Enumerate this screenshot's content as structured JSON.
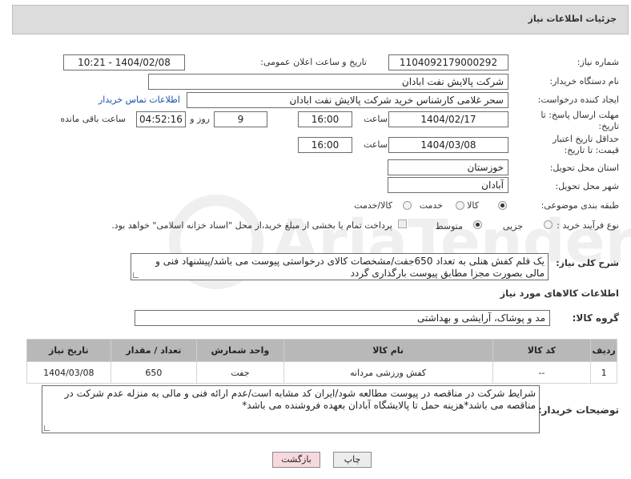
{
  "header": {
    "title": "جزئیات اطلاعات نیاز"
  },
  "fields": {
    "need_number_label": "شماره نیاز:",
    "need_number": "1104092179000292",
    "announce_label": "تاریخ و ساعت اعلان عمومی:",
    "announce_value": "1404/02/08 - 10:21",
    "buyer_org_label": "نام دستگاه خریدار:",
    "buyer_org": "شرکت پالایش نفت ابادان",
    "requester_label": "ایجاد کننده درخواست:",
    "requester": "سحر غلامی کارشناس خرید  شرکت پالایش نفت ابادان",
    "contact_link": "اطلاعات تماس خریدار",
    "deadline_label": "مهلت ارسال پاسخ: تا تاریخ:",
    "deadline_date": "1404/02/17",
    "time_label": "ساعت",
    "deadline_time": "16:00",
    "days_value": "9",
    "days_label": "روز و",
    "remaining_time": "04:52:16",
    "remaining_label": "ساعت باقی مانده",
    "price_validity_label": "حداقل تاریخ اعتبار قیمت: تا تاریخ:",
    "price_validity_date": "1404/03/08",
    "price_validity_time": "16:00",
    "province_label": "استان محل تحویل:",
    "province": "خوزستان",
    "city_label": "شهر محل تحویل:",
    "city": "آبادان",
    "category_label": "طبقه بندی موضوعی:",
    "category_options": [
      "کالا",
      "خدمت",
      "کالا/خدمت"
    ],
    "process_label": "نوع فرآیند خرید :",
    "process_options": [
      "جزیی",
      "متوسط"
    ],
    "payment_note": "پرداخت تمام یا بخشی از مبلغ خرید،از محل \"اسناد خزانه اسلامی\" خواهد بود.",
    "description_label": "شرح کلی نیاز:",
    "description": "یک قلم کفش هنلی به تعداد 650جفت/مشخصات کالای درخواستی پیوست می باشد/پیشنهاد فنی و مالی بصورت مجزا مطابق پیوست بارگذاری گردد"
  },
  "goods_section": {
    "title": "اطلاعات کالاهای مورد نیاز",
    "group_label": "گروه کالا:",
    "group_value": "مد و پوشاک، آرایشی و بهداشتی"
  },
  "table": {
    "headers": [
      "ردیف",
      "کد کالا",
      "نام کالا",
      "واحد شمارش",
      "تعداد / مقدار",
      "تاریخ نیاز"
    ],
    "rows": [
      [
        "1",
        "--",
        "کفش ورزشی مردانه",
        "جفت",
        "650",
        "1404/03/08"
      ]
    ]
  },
  "buyer_notes": {
    "label": "توضیحات خریدار:",
    "text": "شرایط شرکت در مناقصه در پیوست مطالعه شود/ایران کد مشابه است/عدم ارائه فنی و مالی به منزله عدم شرکت در مناقصه می باشد*هزینه حمل تا پالایشگاه آبادان بعهده فروشنده می باشد*"
  },
  "buttons": {
    "print": "چاپ",
    "back": "بازگشت"
  },
  "watermark_text": "AriaTender.neT",
  "colors": {
    "link": "#1a4fa3",
    "header_bg": "#dcdcdc",
    "table_header": "#b8b8b8",
    "back_btn": "#f7d9dd"
  }
}
